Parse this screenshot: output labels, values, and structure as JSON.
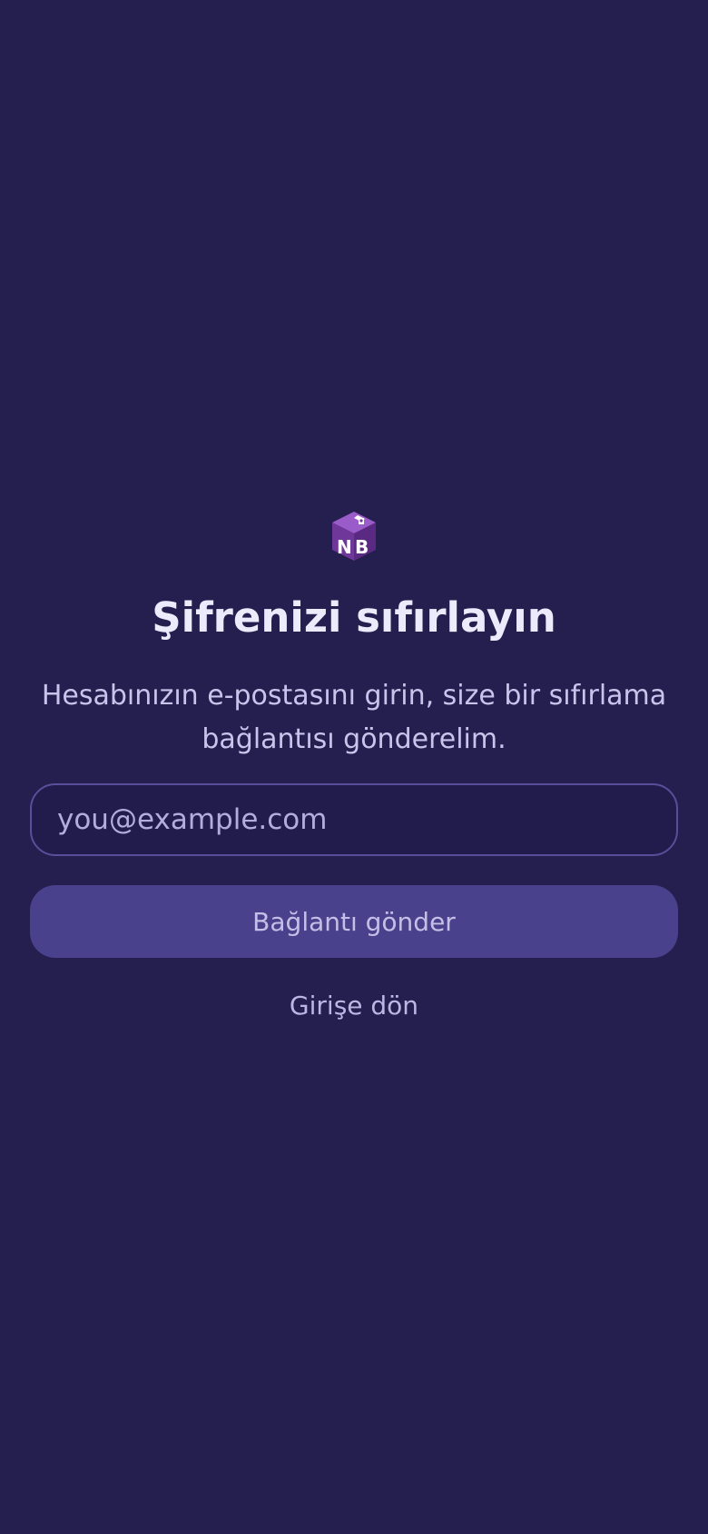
{
  "brand": {
    "logo_icon": "nb-cube-logo-icon",
    "logo_letters": "NB"
  },
  "reset": {
    "title": "Şifrenizi sıfırlayın",
    "subtitle": "Hesabınızın e-postasını girin, size bir sıfırlama bağlantısı gönderelim.",
    "email_value": "",
    "email_placeholder": "you@example.com",
    "send_label": "Bağlantı gönder",
    "back_label": "Girişe dön"
  },
  "colors": {
    "background": "#241f4e",
    "button": "#4a418c",
    "input_border": "#5a4d9a",
    "title_text": "#ecebfb",
    "logo_purple": "#7b3fa6"
  }
}
